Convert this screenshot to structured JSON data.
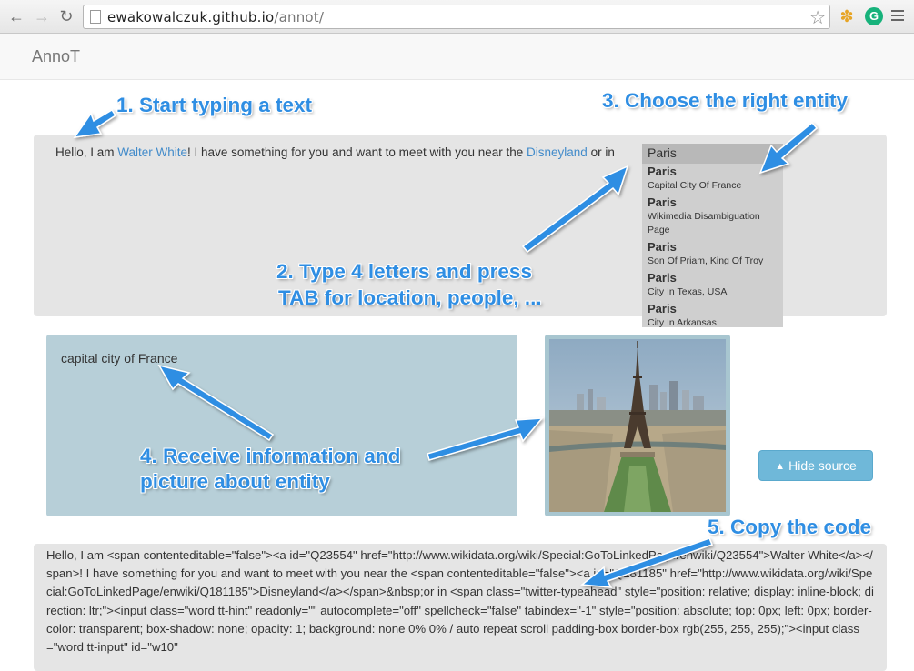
{
  "browser": {
    "url_host": "ewakowalczuk.github.io",
    "url_path": "/annot/"
  },
  "navbar": {
    "brand": "AnnoT"
  },
  "editor": {
    "text_before": "Hello, I am ",
    "link1": "Walter White",
    "text_middle": "! I have something for you and want to meet with you near the ",
    "link2": "Disneyland",
    "text_after": " or in"
  },
  "typeahead": {
    "input_value": "Paris",
    "suggestions": [
      {
        "title": "Paris",
        "description": "Capital City Of France"
      },
      {
        "title": "Paris",
        "description": "Wikimedia Disambiguation Page"
      },
      {
        "title": "Paris",
        "description": "Son Of Priam, King Of Troy"
      },
      {
        "title": "Paris",
        "description": "City In Texas, USA"
      },
      {
        "title": "Paris",
        "description": "City In Arkansas"
      }
    ]
  },
  "info": {
    "text": "capital city of France"
  },
  "buttons": {
    "hide_source": "Hide source"
  },
  "code": {
    "text": "Hello, I am <span contenteditable=\"false\"><a id=\"Q23554\" href=\"http://www.wikidata.org/wiki/Special:GoToLinkedPage/enwiki/Q23554\">Walter White</a></span>! I have something for you and want to meet with you near the <span contenteditable=\"false\"><a id=\"Q181185\" href=\"http://www.wikidata.org/wiki/Special:GoToLinkedPage/enwiki/Q181185\">Disneyland</a></span>&nbsp;or in <span class=\"twitter-typeahead\" style=\"position: relative; display: inline-block; direction: ltr;\"><input class=\"word tt-hint\" readonly=\"\" autocomplete=\"off\" spellcheck=\"false\" tabindex=\"-1\" style=\"position: absolute; top: 0px; left: 0px; border-color: transparent; box-shadow: none; opacity: 1; background: none 0% 0% / auto repeat scroll padding-box border-box rgb(255, 255, 255);\"><input class=\"word tt-input\" id=\"w10\""
  },
  "annotations": {
    "step1": "1. Start typing a text",
    "step2_line1": "2. Type 4 letters and press",
    "step2_line2": "TAB for location, people, ...",
    "step3": "3. Choose the right entity",
    "step4_line1": "4. Receive information and",
    "step4_line2": "picture about entity",
    "step5": "5. Copy the code"
  },
  "colors": {
    "annotation": "#2f8ee3",
    "link": "#428bca",
    "info_bg": "#b7cfd8",
    "button_bg": "#6fb8d9"
  }
}
